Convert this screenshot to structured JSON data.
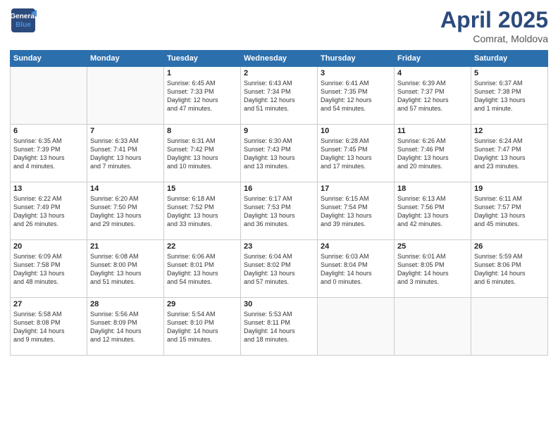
{
  "header": {
    "logo_line1": "General",
    "logo_line2": "Blue",
    "title": "April 2025",
    "location": "Comrat, Moldova"
  },
  "weekdays": [
    "Sunday",
    "Monday",
    "Tuesday",
    "Wednesday",
    "Thursday",
    "Friday",
    "Saturday"
  ],
  "weeks": [
    [
      {
        "day": "",
        "info": ""
      },
      {
        "day": "",
        "info": ""
      },
      {
        "day": "1",
        "info": "Sunrise: 6:45 AM\nSunset: 7:33 PM\nDaylight: 12 hours\nand 47 minutes."
      },
      {
        "day": "2",
        "info": "Sunrise: 6:43 AM\nSunset: 7:34 PM\nDaylight: 12 hours\nand 51 minutes."
      },
      {
        "day": "3",
        "info": "Sunrise: 6:41 AM\nSunset: 7:35 PM\nDaylight: 12 hours\nand 54 minutes."
      },
      {
        "day": "4",
        "info": "Sunrise: 6:39 AM\nSunset: 7:37 PM\nDaylight: 12 hours\nand 57 minutes."
      },
      {
        "day": "5",
        "info": "Sunrise: 6:37 AM\nSunset: 7:38 PM\nDaylight: 13 hours\nand 1 minute."
      }
    ],
    [
      {
        "day": "6",
        "info": "Sunrise: 6:35 AM\nSunset: 7:39 PM\nDaylight: 13 hours\nand 4 minutes."
      },
      {
        "day": "7",
        "info": "Sunrise: 6:33 AM\nSunset: 7:41 PM\nDaylight: 13 hours\nand 7 minutes."
      },
      {
        "day": "8",
        "info": "Sunrise: 6:31 AM\nSunset: 7:42 PM\nDaylight: 13 hours\nand 10 minutes."
      },
      {
        "day": "9",
        "info": "Sunrise: 6:30 AM\nSunset: 7:43 PM\nDaylight: 13 hours\nand 13 minutes."
      },
      {
        "day": "10",
        "info": "Sunrise: 6:28 AM\nSunset: 7:45 PM\nDaylight: 13 hours\nand 17 minutes."
      },
      {
        "day": "11",
        "info": "Sunrise: 6:26 AM\nSunset: 7:46 PM\nDaylight: 13 hours\nand 20 minutes."
      },
      {
        "day": "12",
        "info": "Sunrise: 6:24 AM\nSunset: 7:47 PM\nDaylight: 13 hours\nand 23 minutes."
      }
    ],
    [
      {
        "day": "13",
        "info": "Sunrise: 6:22 AM\nSunset: 7:49 PM\nDaylight: 13 hours\nand 26 minutes."
      },
      {
        "day": "14",
        "info": "Sunrise: 6:20 AM\nSunset: 7:50 PM\nDaylight: 13 hours\nand 29 minutes."
      },
      {
        "day": "15",
        "info": "Sunrise: 6:18 AM\nSunset: 7:52 PM\nDaylight: 13 hours\nand 33 minutes."
      },
      {
        "day": "16",
        "info": "Sunrise: 6:17 AM\nSunset: 7:53 PM\nDaylight: 13 hours\nand 36 minutes."
      },
      {
        "day": "17",
        "info": "Sunrise: 6:15 AM\nSunset: 7:54 PM\nDaylight: 13 hours\nand 39 minutes."
      },
      {
        "day": "18",
        "info": "Sunrise: 6:13 AM\nSunset: 7:56 PM\nDaylight: 13 hours\nand 42 minutes."
      },
      {
        "day": "19",
        "info": "Sunrise: 6:11 AM\nSunset: 7:57 PM\nDaylight: 13 hours\nand 45 minutes."
      }
    ],
    [
      {
        "day": "20",
        "info": "Sunrise: 6:09 AM\nSunset: 7:58 PM\nDaylight: 13 hours\nand 48 minutes."
      },
      {
        "day": "21",
        "info": "Sunrise: 6:08 AM\nSunset: 8:00 PM\nDaylight: 13 hours\nand 51 minutes."
      },
      {
        "day": "22",
        "info": "Sunrise: 6:06 AM\nSunset: 8:01 PM\nDaylight: 13 hours\nand 54 minutes."
      },
      {
        "day": "23",
        "info": "Sunrise: 6:04 AM\nSunset: 8:02 PM\nDaylight: 13 hours\nand 57 minutes."
      },
      {
        "day": "24",
        "info": "Sunrise: 6:03 AM\nSunset: 8:04 PM\nDaylight: 14 hours\nand 0 minutes."
      },
      {
        "day": "25",
        "info": "Sunrise: 6:01 AM\nSunset: 8:05 PM\nDaylight: 14 hours\nand 3 minutes."
      },
      {
        "day": "26",
        "info": "Sunrise: 5:59 AM\nSunset: 8:06 PM\nDaylight: 14 hours\nand 6 minutes."
      }
    ],
    [
      {
        "day": "27",
        "info": "Sunrise: 5:58 AM\nSunset: 8:08 PM\nDaylight: 14 hours\nand 9 minutes."
      },
      {
        "day": "28",
        "info": "Sunrise: 5:56 AM\nSunset: 8:09 PM\nDaylight: 14 hours\nand 12 minutes."
      },
      {
        "day": "29",
        "info": "Sunrise: 5:54 AM\nSunset: 8:10 PM\nDaylight: 14 hours\nand 15 minutes."
      },
      {
        "day": "30",
        "info": "Sunrise: 5:53 AM\nSunset: 8:11 PM\nDaylight: 14 hours\nand 18 minutes."
      },
      {
        "day": "",
        "info": ""
      },
      {
        "day": "",
        "info": ""
      },
      {
        "day": "",
        "info": ""
      }
    ]
  ]
}
